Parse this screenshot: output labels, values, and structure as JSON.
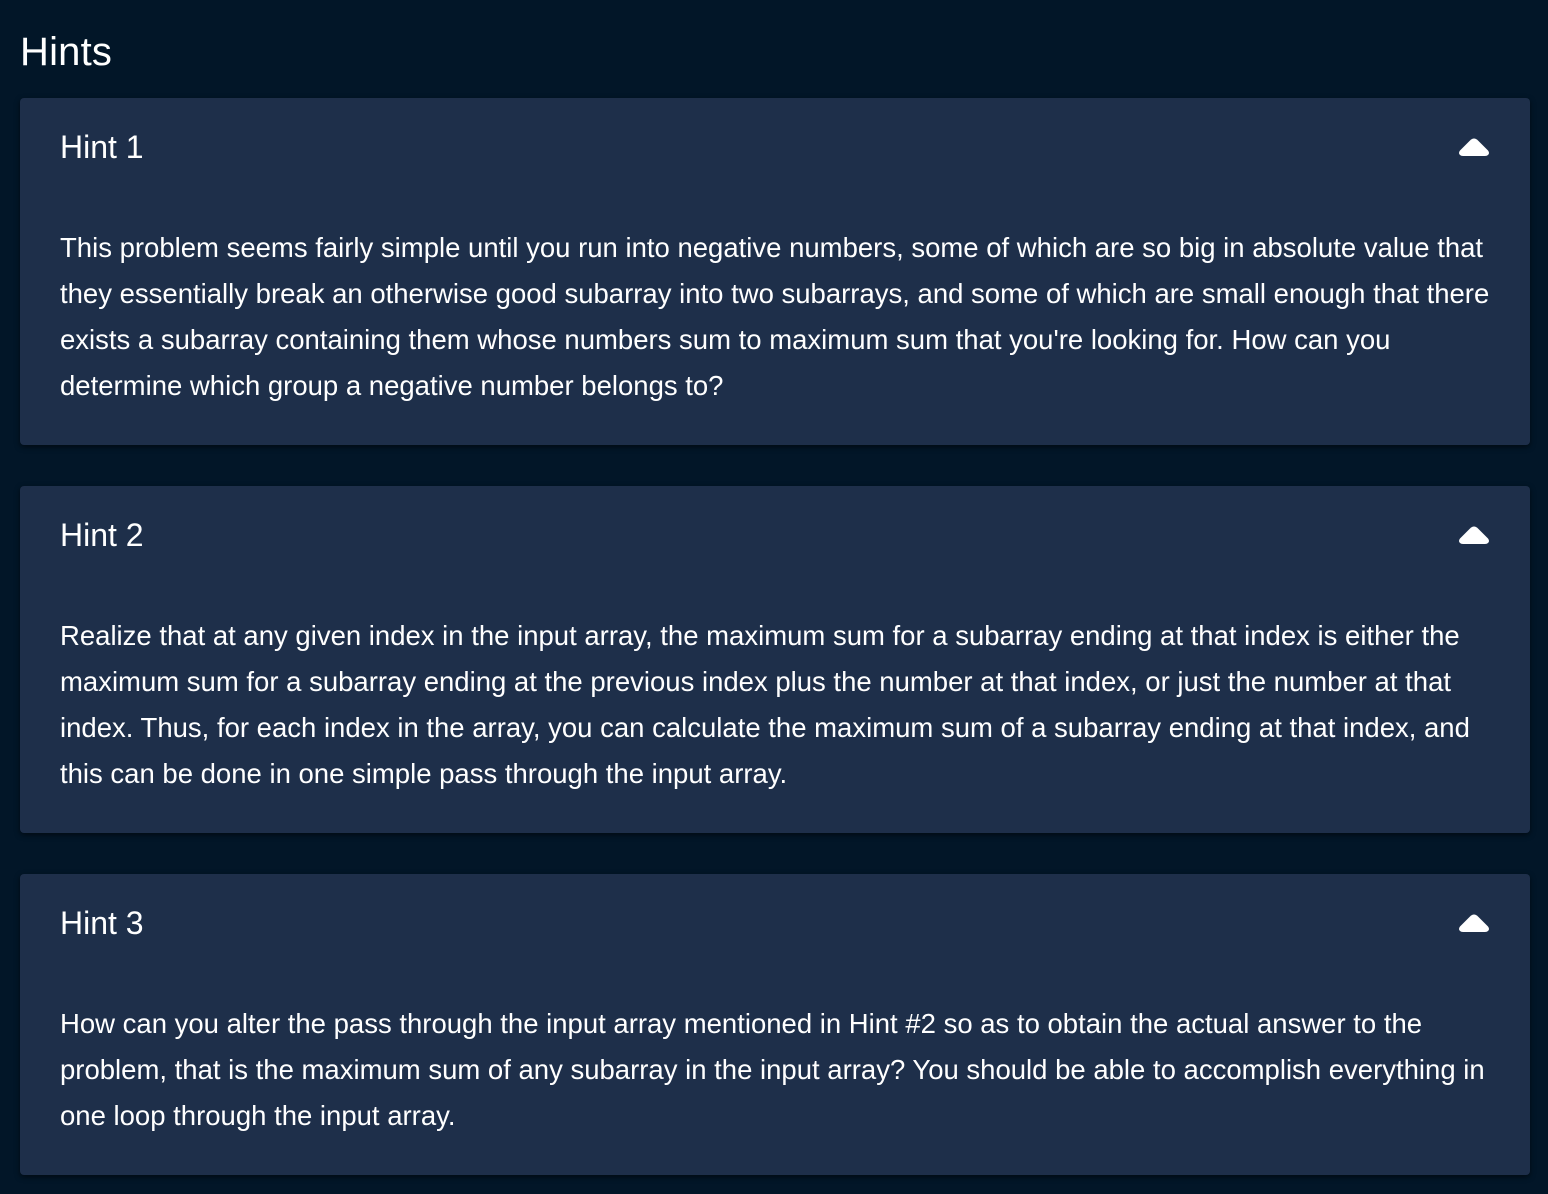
{
  "page": {
    "title": "Hints"
  },
  "hints": [
    {
      "title": "Hint 1",
      "expanded": true,
      "toggle_icon": "chevron-up-icon",
      "body": "This problem seems fairly simple until you run into negative numbers, some of which are so big in absolute value that they essentially break an otherwise good subarray into two subarrays, and some of which are small enough that there exists a subarray containing them whose numbers sum to maximum sum that you're looking for. How can you determine which group a negative number belongs to?"
    },
    {
      "title": "Hint 2",
      "expanded": true,
      "toggle_icon": "chevron-up-icon",
      "body": "Realize that at any given index in the input array, the maximum sum for a subarray ending at that index is either the maximum sum for a subarray ending at the previous index plus the number at that index, or just the number at that index. Thus, for each index in the array, you can calculate the maximum sum of a subarray ending at that index, and this can be done in one simple pass through the input array."
    },
    {
      "title": "Hint 3",
      "expanded": true,
      "toggle_icon": "chevron-up-icon",
      "body": "How can you alter the pass through the input array mentioned in Hint #2 so as to obtain the actual answer to the problem, that is the maximum sum of any subarray in the input array? You should be able to accomplish everything in one loop through the input array."
    }
  ],
  "colors": {
    "page_background": "#021628",
    "card_background": "#1e2f4a",
    "text": "#ffffff"
  }
}
